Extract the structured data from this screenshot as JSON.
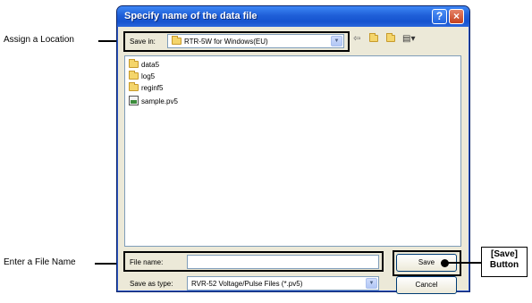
{
  "dialog": {
    "title": "Specify name of the data file",
    "help_symbol": "?",
    "close_symbol": "×"
  },
  "location": {
    "label": "Save in:",
    "value": "RTR-5W for Windows(EU)",
    "icons": [
      "back-arrow-icon",
      "up-folder-icon",
      "new-folder-icon",
      "view-menu-icon"
    ]
  },
  "files": [
    {
      "name": "data5",
      "type": "folder"
    },
    {
      "name": "log5",
      "type": "folder"
    },
    {
      "name": "reginf5",
      "type": "folder"
    },
    {
      "name": "sample.pv5",
      "type": "file"
    }
  ],
  "filename": {
    "label": "File name:",
    "value": ""
  },
  "savetype": {
    "label": "Save as type:",
    "value": "RVR-52 Voltage/Pulse Files (*.pv5)"
  },
  "buttons": {
    "save": "Save",
    "cancel": "Cancel"
  },
  "callouts": {
    "location": "Assign a Location",
    "filename": "Enter a File Name",
    "save_line1": "[Save]",
    "save_line2": "Button"
  }
}
